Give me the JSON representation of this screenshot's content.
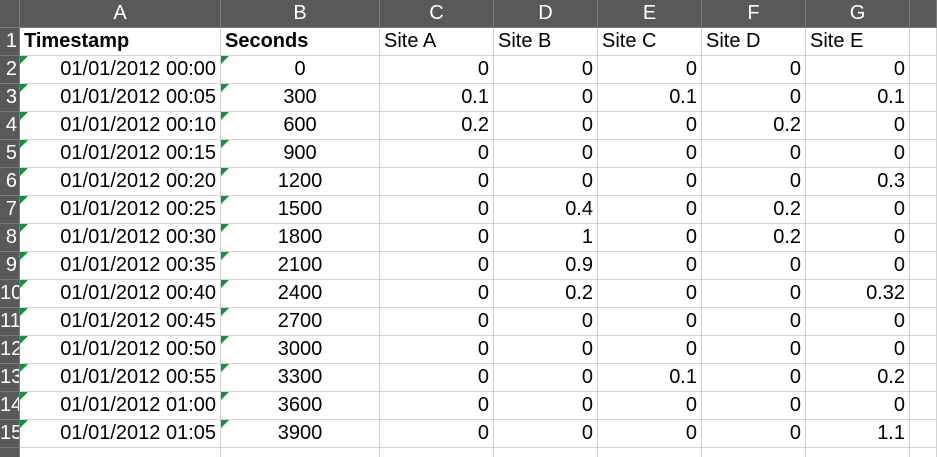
{
  "columns": [
    "A",
    "B",
    "C",
    "D",
    "E",
    "F",
    "G"
  ],
  "headers": [
    "Timestamp",
    "Seconds",
    "Site A",
    "Site B",
    "Site C",
    "Site D",
    "Site E"
  ],
  "rows": [
    {
      "n": "2",
      "ts": "01/01/2012 00:00",
      "sec": "0",
      "a": "0",
      "b": "0",
      "c": "0",
      "d": "0",
      "e": "0"
    },
    {
      "n": "3",
      "ts": "01/01/2012 00:05",
      "sec": "300",
      "a": "0.1",
      "b": "0",
      "c": "0.1",
      "d": "0",
      "e": "0.1"
    },
    {
      "n": "4",
      "ts": "01/01/2012 00:10",
      "sec": "600",
      "a": "0.2",
      "b": "0",
      "c": "0",
      "d": "0.2",
      "e": "0"
    },
    {
      "n": "5",
      "ts": "01/01/2012 00:15",
      "sec": "900",
      "a": "0",
      "b": "0",
      "c": "0",
      "d": "0",
      "e": "0"
    },
    {
      "n": "6",
      "ts": "01/01/2012 00:20",
      "sec": "1200",
      "a": "0",
      "b": "0",
      "c": "0",
      "d": "0",
      "e": "0.3"
    },
    {
      "n": "7",
      "ts": "01/01/2012 00:25",
      "sec": "1500",
      "a": "0",
      "b": "0.4",
      "c": "0",
      "d": "0.2",
      "e": "0"
    },
    {
      "n": "8",
      "ts": "01/01/2012 00:30",
      "sec": "1800",
      "a": "0",
      "b": "1",
      "c": "0",
      "d": "0.2",
      "e": "0"
    },
    {
      "n": "9",
      "ts": "01/01/2012 00:35",
      "sec": "2100",
      "a": "0",
      "b": "0.9",
      "c": "0",
      "d": "0",
      "e": "0"
    },
    {
      "n": "10",
      "ts": "01/01/2012 00:40",
      "sec": "2400",
      "a": "0",
      "b": "0.2",
      "c": "0",
      "d": "0",
      "e": "0.32"
    },
    {
      "n": "11",
      "ts": "01/01/2012 00:45",
      "sec": "2700",
      "a": "0",
      "b": "0",
      "c": "0",
      "d": "0",
      "e": "0"
    },
    {
      "n": "12",
      "ts": "01/01/2012 00:50",
      "sec": "3000",
      "a": "0",
      "b": "0",
      "c": "0",
      "d": "0",
      "e": "0"
    },
    {
      "n": "13",
      "ts": "01/01/2012 00:55",
      "sec": "3300",
      "a": "0",
      "b": "0",
      "c": "0.1",
      "d": "0",
      "e": "0.2"
    },
    {
      "n": "14",
      "ts": "01/01/2012 01:00",
      "sec": "3600",
      "a": "0",
      "b": "0",
      "c": "0",
      "d": "0",
      "e": "0"
    },
    {
      "n": "15",
      "ts": "01/01/2012 01:05",
      "sec": "3900",
      "a": "0",
      "b": "0",
      "c": "0",
      "d": "0",
      "e": "1.1"
    }
  ],
  "colors": {
    "header_bg": "#595959",
    "header_text": "#ffffff",
    "gridline": "#d4d4d4",
    "error_triangle": "#1e8e3e"
  }
}
